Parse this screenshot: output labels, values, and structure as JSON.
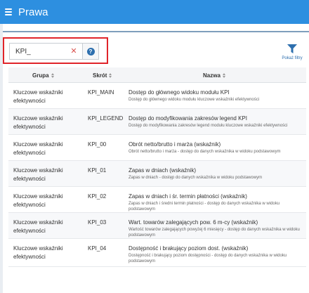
{
  "app": {
    "title": "Prawa"
  },
  "search": {
    "value": "KPI_",
    "clear_symbol": "✕",
    "help_symbol": "?"
  },
  "filter": {
    "label": "Pokaż filtry"
  },
  "table": {
    "headers": {
      "group": "Grupa",
      "code": "Skrót",
      "name": "Nazwa"
    },
    "rows": [
      {
        "group": "Kluczowe wskaźniki efektywności",
        "code": "KPI_MAIN",
        "title": "Dostęp do głównego widoku modułu KPI",
        "desc": "Dostęp do głównego widoku modułu kluczowe wskaźniki efektywności"
      },
      {
        "group": "Kluczowe wskaźniki efektywności",
        "code": "KPI_LEGEND",
        "title": "Dostęp do modyfikowania zakresów legend KPI",
        "desc": "Dostęp do modyfikowania zakresów legend modułu kluczowe wskaźniki efektywności"
      },
      {
        "group": "Kluczowe wskaźniki efektywności",
        "code": "KPI_00",
        "title": "Obrót netto/brutto i marża (wskaźnik)",
        "desc": "Obrót netto/brutto i marża - dostęp do danych wskaźnika w widoku podstawowym"
      },
      {
        "group": "Kluczowe wskaźniki efektywności",
        "code": "KPI_01",
        "title": "Zapas w dniach (wskaźnik)",
        "desc": "Zapas w dniach - dostęp do danych wskaźnika w widoku podstawowym"
      },
      {
        "group": "Kluczowe wskaźniki efektywności",
        "code": "KPI_02",
        "title": "Zapas w dniach i śr. termin płatności (wskaźnik)",
        "desc": "Zapas w dniach i średni termin płatności - dostęp do danych wskaźnika w widoku podstawowym"
      },
      {
        "group": "Kluczowe wskaźniki efektywności",
        "code": "KPI_03",
        "title": "Wart. towarów zalegających pow. 6 m-cy (wskaźnik)",
        "desc": "Wartość towarów zalegających powyżej 6 miesięcy - dostęp do danych wskaźnika w widoku podstawowym"
      },
      {
        "group": "Kluczowe wskaźniki efektywności",
        "code": "KPI_04",
        "title": "Dostępność i brakujący poziom dost. (wskaźnik)",
        "desc": "Dostępność i brakujący poziom dostępności - dostęp do danych wskaźnika w widoku podstawowym"
      }
    ]
  },
  "colors": {
    "topbar": "#2d8fe0",
    "highlight": "#e0242a",
    "accent": "#2d6fae"
  },
  "icons": [
    "menu-icon",
    "clear-icon",
    "help-icon",
    "filter-icon",
    "sort-icon"
  ]
}
